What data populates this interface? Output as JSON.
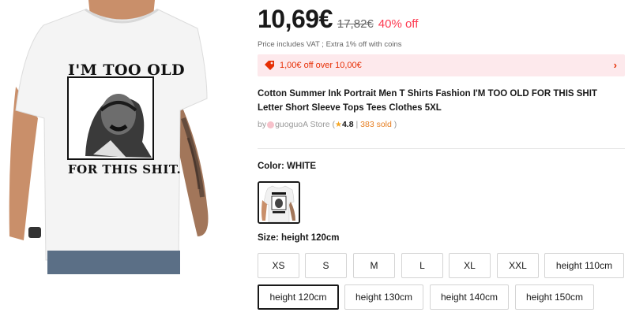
{
  "product": {
    "price_current": "10,69€",
    "price_original": "17,82€",
    "discount": "40% off",
    "vat_note": "Price includes VAT ; Extra 1% off with coins",
    "coupon_text": "1,00€ off over 10,00€",
    "title": "Cotton Summer Ink Portrait Men T Shirts Fashion I'M TOO OLD FOR THIS SHIT Letter Short Sleeve Tops Tees Clothes 5XL",
    "image_text_top": "I'M TOO OLD",
    "image_text_bottom": "FOR THIS SHIT."
  },
  "store": {
    "prefix": "by",
    "name": "guoguoA Store",
    "open_paren": "(",
    "rating_star": "★",
    "rating": "4.8",
    "separator": "|",
    "sold": "383 sold",
    "close_paren": ")"
  },
  "color": {
    "label": "Color: WHITE"
  },
  "size": {
    "label": "Size: height 120cm",
    "options": [
      "XS",
      "S",
      "M",
      "L",
      "XL",
      "XXL",
      "height 110cm",
      "height 120cm",
      "height 130cm",
      "height 140cm",
      "height 150cm"
    ],
    "selected": "height 120cm"
  },
  "icons": {
    "coupon": "coupon-tag-icon",
    "chevron": "chevron-right-icon"
  },
  "colors": {
    "accent": "#fd384f",
    "coupon_bg": "#fde9ec",
    "coupon_text": "#e62e04"
  }
}
